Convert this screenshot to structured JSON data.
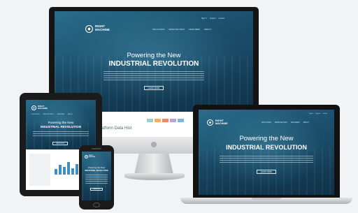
{
  "brand": {
    "line1": "RIGHT",
    "line2": "MACHINE"
  },
  "nav": [
    "SOLUTIONS",
    "MONITOR-TEST",
    "FEATURES",
    "ABOUT"
  ],
  "top_links": [
    "Sign In",
    "Support",
    "Contact"
  ],
  "hero": {
    "line1": "Powering the New",
    "line2": "INDUSTRIAL REVOLUTION",
    "button": "LEARN MORE"
  },
  "monitor_peek_text": "atform Data Hist",
  "colors": {
    "background": "#f2f3f4",
    "site_blue": "#1b4f6c",
    "device_black": "#151515",
    "swatches": [
      "#9ad0c9",
      "#f0b45a",
      "#e98a6c",
      "#b7a1d6",
      "#7fb6e0"
    ]
  }
}
